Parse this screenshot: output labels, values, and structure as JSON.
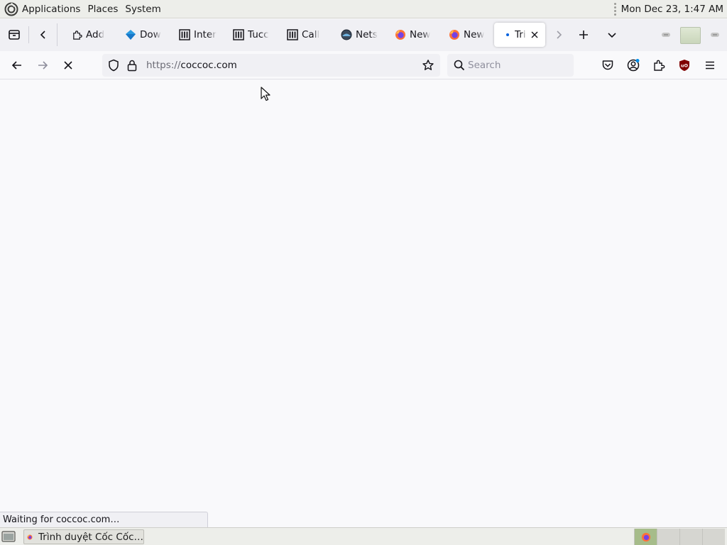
{
  "top_panel": {
    "menus": [
      "Applications",
      "Places",
      "System"
    ],
    "clock": "Mon Dec 23, 1:47 AM"
  },
  "tabs": [
    {
      "title": "Add",
      "icon": "puzzle-icon"
    },
    {
      "title": "Dow",
      "icon": "blue-diamond-icon"
    },
    {
      "title": "Inter",
      "icon": "archive-building-icon"
    },
    {
      "title": "Tucc",
      "icon": "archive-building-icon"
    },
    {
      "title": "Call",
      "icon": "archive-building-icon"
    },
    {
      "title": "Nets",
      "icon": "netsurf-icon"
    },
    {
      "title": "New",
      "icon": "firefox-icon"
    },
    {
      "title": "New",
      "icon": "firefox-icon"
    },
    {
      "title": "Tri",
      "icon": "loading-dot-icon",
      "active": true
    }
  ],
  "navbar": {
    "url_protocol": "https://",
    "url_host": "coccoc.com",
    "search_placeholder": "Search"
  },
  "status_text": "Waiting for coccoc.com…",
  "taskbar": {
    "window_title": "Trình duyệt Cốc Cốc…"
  },
  "colors": {
    "tab_strip_bg": "#f0f0f4",
    "toolbar_bg": "#f9f9fb",
    "panel_bg": "#edeeea",
    "active_workspace": "#a6bc8a",
    "ublock_red": "#800000",
    "accent_blue": "#0060df"
  }
}
